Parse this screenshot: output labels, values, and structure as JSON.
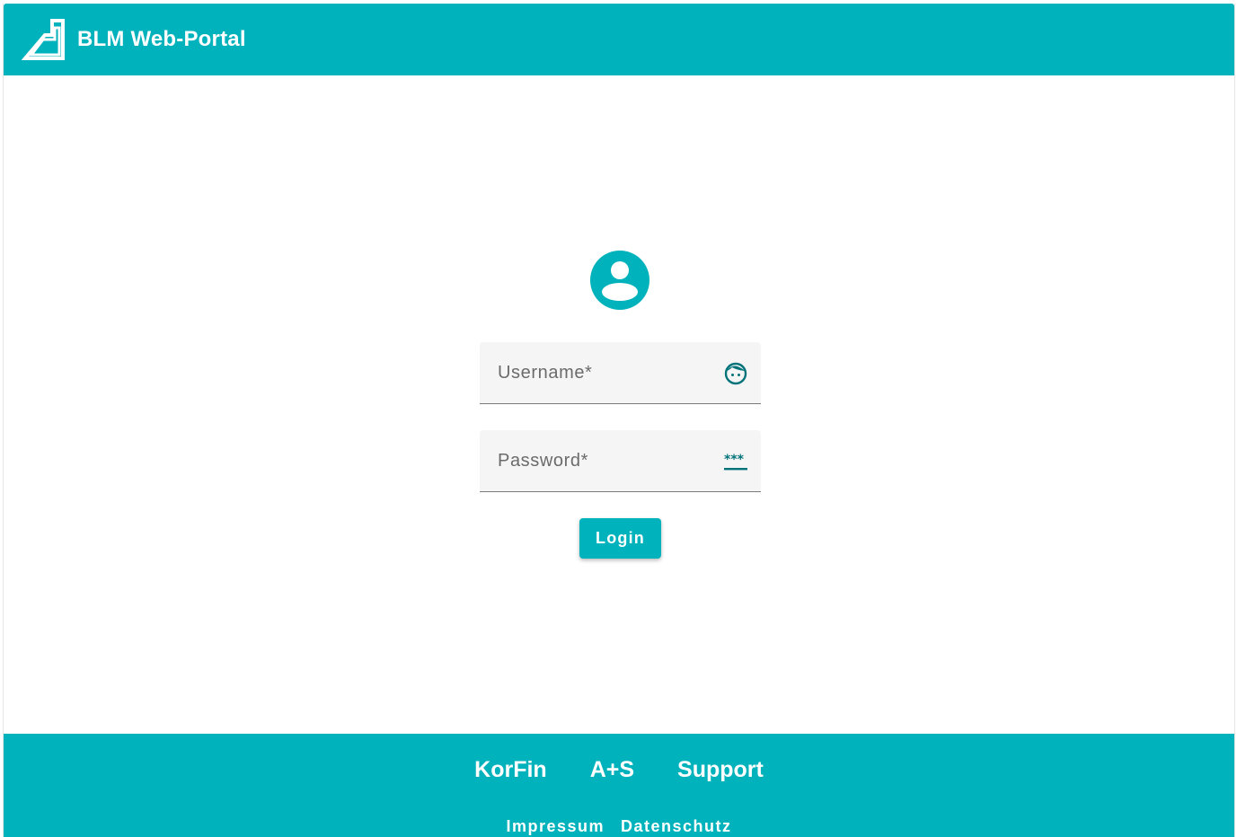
{
  "header": {
    "title": "BLM Web-Portal",
    "logo_icon": "chart-step-logo-icon"
  },
  "login": {
    "avatar_icon": "account-circle-icon",
    "username": {
      "placeholder": "Username*",
      "value": "",
      "icon": "face-icon"
    },
    "password": {
      "placeholder": "Password*",
      "value": "",
      "icon": "password-icon"
    },
    "login_label": "Login"
  },
  "footer": {
    "nav": [
      "KorFin",
      "A+S",
      "Support"
    ],
    "links": [
      "Impressum",
      "Datenschutz"
    ]
  },
  "colors": {
    "brand": "#00b2bb",
    "field_bg": "#f5f5f5",
    "icon_dark": "#00737a"
  }
}
